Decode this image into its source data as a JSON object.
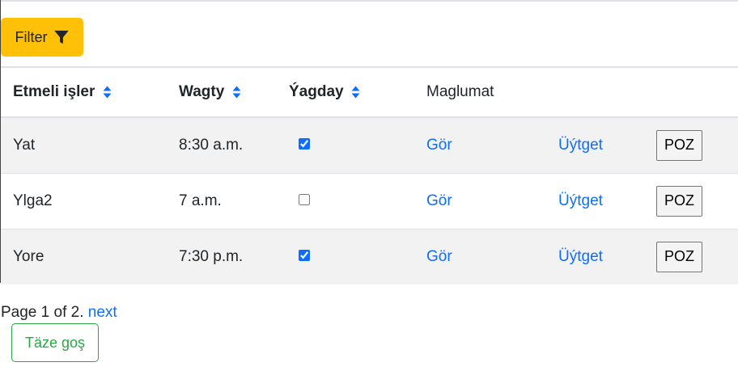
{
  "filter": {
    "label": "Filter",
    "icon": "funnel-icon",
    "color": "#ffc107"
  },
  "table": {
    "headers": {
      "task": "Etmeli işler",
      "time": "Wagty",
      "status": "Ýagday",
      "info": "Maglumat"
    },
    "sort_icon": "sort-arrows-icon",
    "rows": [
      {
        "task": "Yat",
        "time": "8:30 a.m.",
        "done": true,
        "view": "Gör",
        "edit": "Üýtget",
        "delete": "POZ"
      },
      {
        "task": "Ylga2",
        "time": "7 a.m.",
        "done": false,
        "view": "Gör",
        "edit": "Üýtget",
        "delete": "POZ"
      },
      {
        "task": "Yore",
        "time": "7:30 p.m.",
        "done": true,
        "view": "Gör",
        "edit": "Üýtget",
        "delete": "POZ"
      }
    ]
  },
  "pagination": {
    "text": "Page 1 of 2.",
    "next": "next"
  },
  "add_button": {
    "label": "Täze goş",
    "color": "#28a745"
  },
  "colors": {
    "link": "#0d6efd",
    "stripe": "#f2f2f2"
  }
}
